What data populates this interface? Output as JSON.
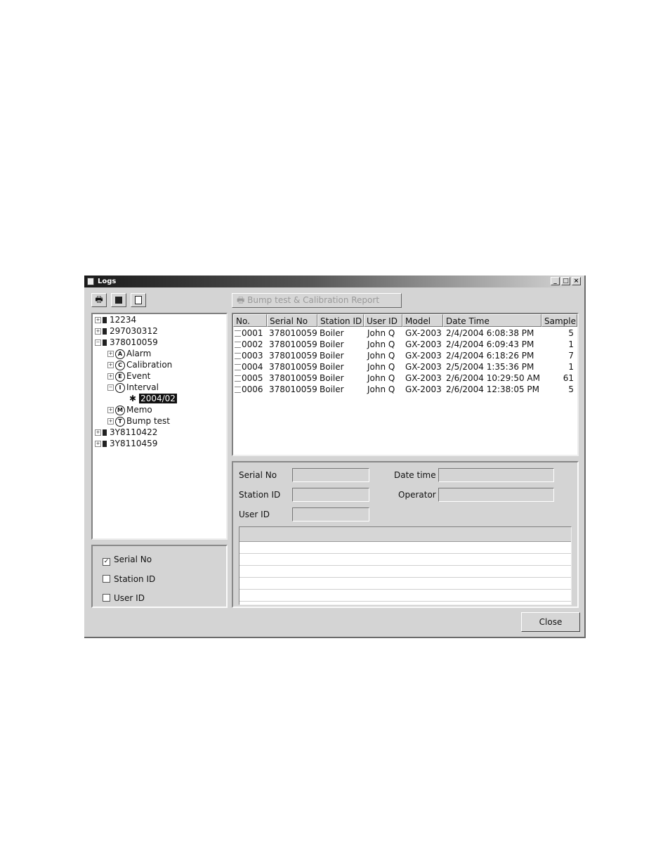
{
  "window": {
    "title": "Logs"
  },
  "toolbar": {
    "print_icon": "printer-icon",
    "save_icon": "floppy-icon",
    "clipboard_icon": "clipboard-icon",
    "report_button": "Bump test & Calibration Report"
  },
  "tree": {
    "devices": [
      {
        "label": "12234",
        "expanded": false
      },
      {
        "label": "297030312",
        "expanded": false
      },
      {
        "label": "378010059",
        "expanded": true
      },
      {
        "label": "3Y8110422",
        "expanded": false
      },
      {
        "label": "3Y8110459",
        "expanded": false
      }
    ],
    "children": [
      {
        "glyph": "A",
        "label": "Alarm"
      },
      {
        "glyph": "C",
        "label": "Calibration"
      },
      {
        "glyph": "E",
        "label": "Event"
      },
      {
        "glyph": "I",
        "label": "Interval"
      },
      {
        "glyph": "M",
        "label": "Memo"
      },
      {
        "glyph": "T",
        "label": "Bump test"
      }
    ],
    "interval_child": "2004/02"
  },
  "filters": [
    {
      "label": "Serial No",
      "checked": true
    },
    {
      "label": "Station ID",
      "checked": false
    },
    {
      "label": "User ID",
      "checked": false
    }
  ],
  "table": {
    "columns": [
      "No.",
      "Serial No",
      "Station ID",
      "User ID",
      "Model",
      "Date Time",
      "Sample"
    ],
    "rows": [
      [
        "0001",
        "378010059",
        "Boiler",
        "John Q",
        "GX-2003",
        "2/4/2004 6:08:38 PM",
        "5"
      ],
      [
        "0002",
        "378010059",
        "Boiler",
        "John Q",
        "GX-2003",
        "2/4/2004 6:09:43 PM",
        "1"
      ],
      [
        "0003",
        "378010059",
        "Boiler",
        "John Q",
        "GX-2003",
        "2/4/2004 6:18:26 PM",
        "7"
      ],
      [
        "0004",
        "378010059",
        "Boiler",
        "John Q",
        "GX-2003",
        "2/5/2004 1:35:36 PM",
        "1"
      ],
      [
        "0005",
        "378010059",
        "Boiler",
        "John Q",
        "GX-2003",
        "2/6/2004 10:29:50 AM",
        "61"
      ],
      [
        "0006",
        "378010059",
        "Boiler",
        "John Q",
        "GX-2003",
        "2/6/2004 12:38:05 PM",
        "5"
      ]
    ]
  },
  "details": {
    "serial_label": "Serial No",
    "station_label": "Station ID",
    "user_label": "User ID",
    "datetime_label": "Date time",
    "operator_label": "Operator"
  },
  "close_button": "Close"
}
